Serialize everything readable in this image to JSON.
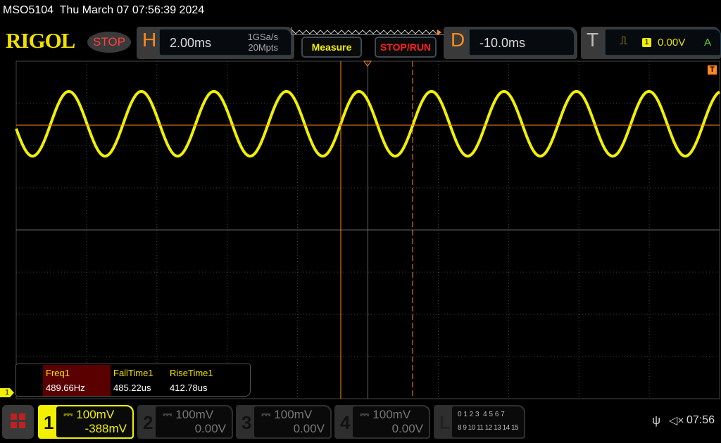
{
  "header": {
    "model": "MSO5104",
    "datetime": "Thu March 07 07:56:39 2024"
  },
  "brand": {
    "logo": "RIGOL",
    "status": "STOP"
  },
  "horizontal": {
    "letter": "H",
    "timebase": "2.00ms",
    "sample_rate": "1GSa/s",
    "memory_depth": "20Mpts"
  },
  "buttons": {
    "measure": "Measure",
    "stop_run": "STOP/RUN"
  },
  "delay": {
    "letter": "D",
    "value": "-10.0ms"
  },
  "trigger": {
    "letter": "T",
    "source": "1",
    "level": "0.00V",
    "mode": "A",
    "marker": "T"
  },
  "measurements": [
    {
      "label": "Freq1",
      "value": "489.66Hz"
    },
    {
      "label": "FallTime1",
      "value": "485.22us"
    },
    {
      "label": "RiseTime1",
      "value": "412.78us"
    }
  ],
  "ch1_marker": "1",
  "channels": [
    {
      "num": "1",
      "scale": "100mV",
      "offset": "-388mV",
      "active": true
    },
    {
      "num": "2",
      "scale": "100mV",
      "offset": "0.00V",
      "active": false
    },
    {
      "num": "3",
      "scale": "100mV",
      "offset": "0.00V",
      "active": false
    },
    {
      "num": "4",
      "scale": "100mV",
      "offset": "0.00V",
      "active": false
    }
  ],
  "logic": {
    "letter": "L",
    "row1": "0 1 2 3  4 5 6 7",
    "row2": "8 9 10 11 12 13 14 15"
  },
  "status_bar": {
    "time": "07:56"
  },
  "colors": {
    "ch1": "#f0f000",
    "cursor": "#ff8a1c",
    "grid": "#444444"
  }
}
